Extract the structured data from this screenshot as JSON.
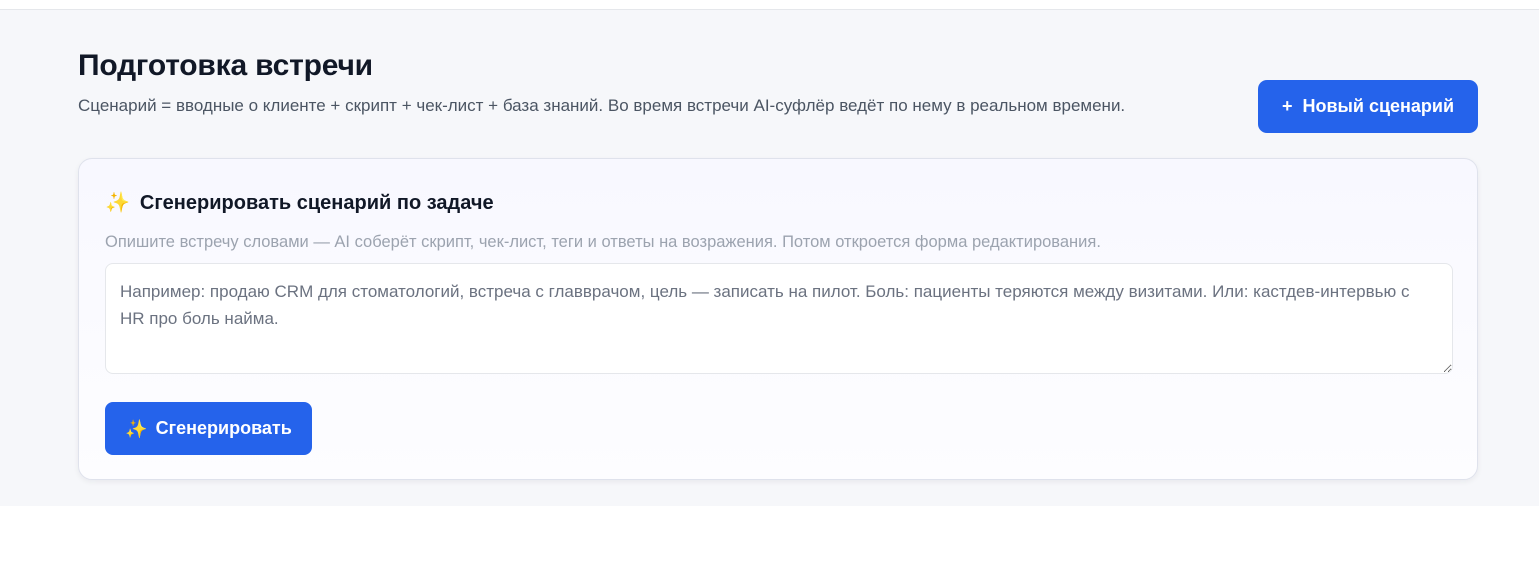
{
  "header": {
    "title": "Подготовка встречи",
    "subtitle": "Сценарий = вводные о клиенте + скрипт + чек-лист + база знаний. Во время встречи AI-суфлёр ведёт по нему в реальном времени.",
    "new_button": {
      "icon": "+",
      "label": "Новый сценарий"
    }
  },
  "generator": {
    "icon": "✨",
    "title": "Сгенерировать сценарий по задаче",
    "description": "Опишите встречу словами — AI соберёт скрипт, чек-лист, теги и ответы на возражения. Потом откроется форма редактирования.",
    "textarea": {
      "value": "",
      "placeholder": "Например: продаю CRM для стоматологий, встреча с главврачом, цель — записать на пилот. Боль: пациенты теряются между визитами. Или: кастдев-интервью с HR про боль найма."
    },
    "generate_button": {
      "icon": "✨",
      "label": "Сгенерировать"
    }
  },
  "colors": {
    "accent": "#2563eb",
    "page_bg": "#f6f7fa",
    "muted_text": "#9ca3af"
  }
}
